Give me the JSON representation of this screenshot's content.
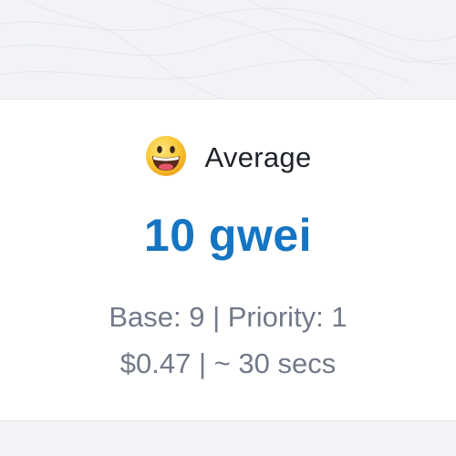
{
  "card": {
    "icon": "grinning-face-icon",
    "title": "Average",
    "price": "10 gwei",
    "fee_breakdown": "Base: 9 | Priority: 1",
    "cost_and_time": "$0.47 | ~ 30 secs"
  },
  "colors": {
    "price": "#1575c2",
    "subtext": "#727988",
    "title": "#1e2229",
    "background": "#f3f4f7",
    "card": "#ffffff"
  }
}
